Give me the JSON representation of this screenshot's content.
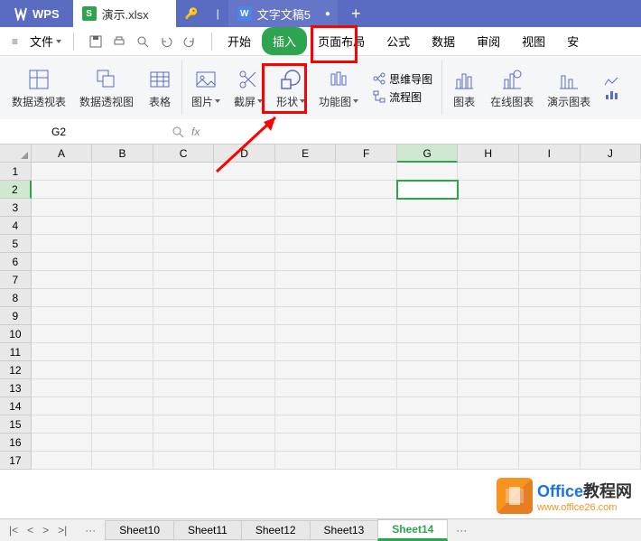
{
  "titlebar": {
    "app_name": "WPS",
    "tabs": [
      {
        "icon": "S",
        "label": "演示.xlsx"
      },
      {
        "icon": "W",
        "label": "文字文稿5"
      }
    ]
  },
  "menubar": {
    "file_label": "文件",
    "ribbon_tabs": [
      "开始",
      "插入",
      "页面布局",
      "公式",
      "数据",
      "审阅",
      "视图",
      "安"
    ]
  },
  "ribbon": {
    "pivot_table": "数据透视表",
    "pivot_chart": "数据透视图",
    "table": "表格",
    "picture": "图片",
    "screenshot": "截屏",
    "shapes": "形状",
    "smartart": "功能图",
    "mindmap": "思维导图",
    "flowchart": "流程图",
    "chart": "图表",
    "online_chart": "在线图表",
    "demo_chart": "演示图表"
  },
  "formula_bar": {
    "name_box": "G2",
    "fx": "fx"
  },
  "grid": {
    "columns": [
      "A",
      "B",
      "C",
      "D",
      "E",
      "F",
      "G",
      "H",
      "I",
      "J"
    ],
    "rows": [
      "1",
      "2",
      "3",
      "4",
      "5",
      "6",
      "7",
      "8",
      "9",
      "10",
      "11",
      "12",
      "13",
      "14",
      "15",
      "16",
      "17"
    ],
    "active_col": "G",
    "active_row": "2"
  },
  "sheets": {
    "tabs": [
      "Sheet10",
      "Sheet11",
      "Sheet12",
      "Sheet13",
      "Sheet14"
    ],
    "active": "Sheet14",
    "ellipsis": "···"
  },
  "watermark": {
    "title_part1": "Office",
    "title_part2": "教程网",
    "url": "www.office26.com"
  }
}
